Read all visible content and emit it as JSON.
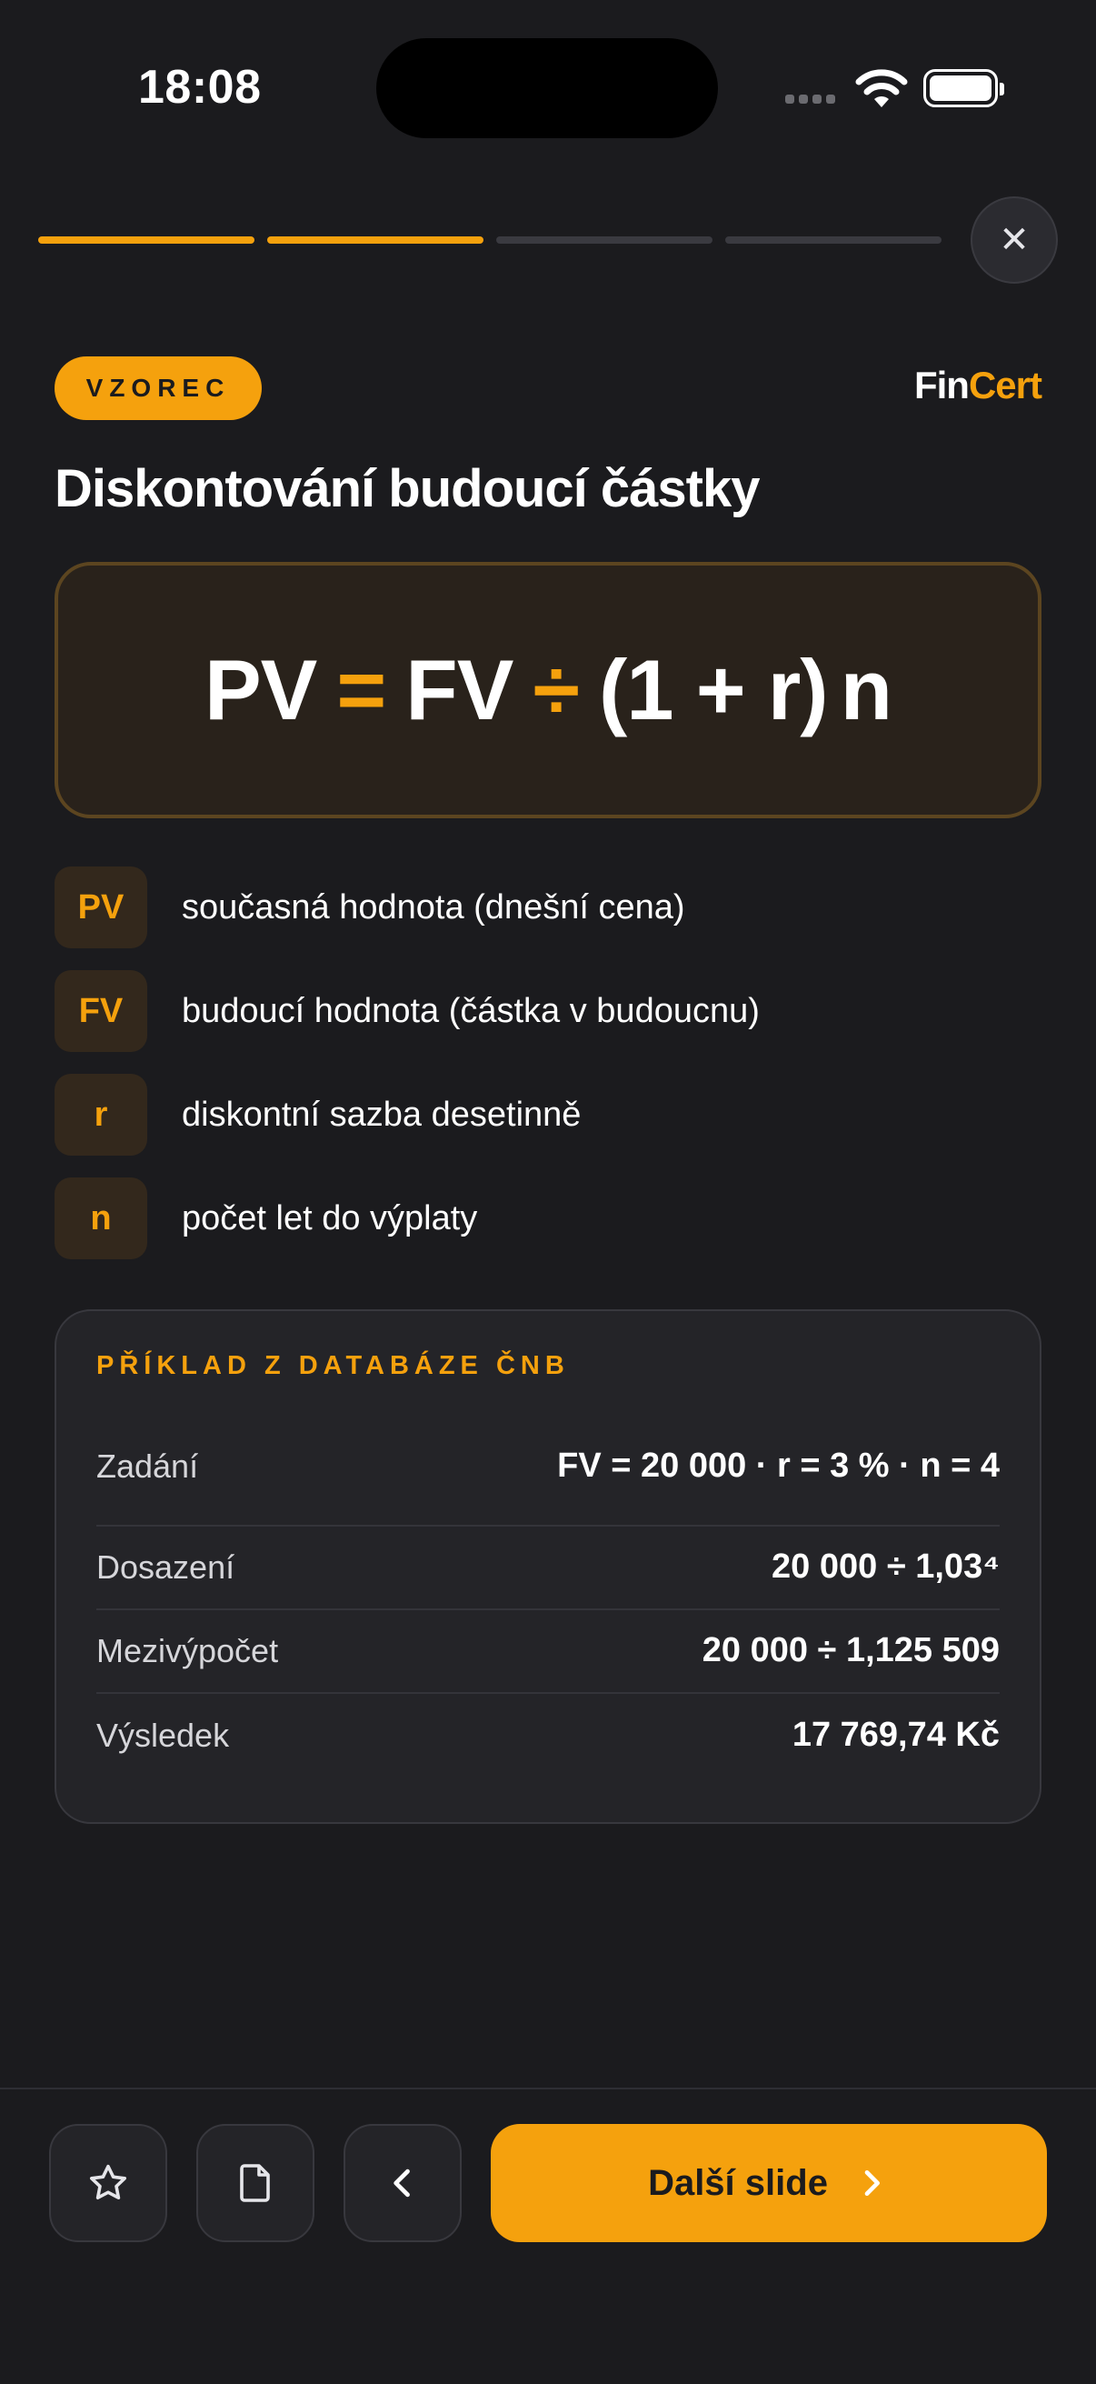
{
  "status": {
    "time": "18:08"
  },
  "progress": {
    "total": 4,
    "completed": 2
  },
  "close": {
    "icon": "close-icon",
    "glyph": "✕"
  },
  "header": {
    "tag": "VZOREC",
    "brand_part1": "Fin",
    "brand_part2": "Cert"
  },
  "title": "Diskontování budoucí částky",
  "formula": {
    "pv": "PV",
    "eq": "=",
    "fv": "FV",
    "div": "÷",
    "group": "(1 + r)",
    "exp": "n"
  },
  "legend": [
    {
      "symbol": "PV",
      "text": "současná hodnota (dnešní cena)"
    },
    {
      "symbol": "FV",
      "text": "budoucí hodnota (částka v budoucnu)"
    },
    {
      "symbol": "r",
      "text": "diskontní sazba desetinně"
    },
    {
      "symbol": "n",
      "text": "počet let do výplaty"
    }
  ],
  "example": {
    "title": "PŘÍKLAD Z DATABÁZE ČNB",
    "rows": [
      {
        "label": "Zadání",
        "value": "FV = 20 000 · r = 3 % · n = 4"
      },
      {
        "label": "Dosazení",
        "value": "20 000 ÷ 1,03⁴"
      },
      {
        "label": "Mezivýpočet",
        "value": "20 000 ÷ 1,125 509"
      },
      {
        "label": "Výsledek",
        "value": "17 769,74 Kč"
      }
    ]
  },
  "bottom": {
    "next_label": "Další slide",
    "icons": [
      "star-icon",
      "document-icon",
      "chevron-left-icon",
      "chevron-right-icon"
    ]
  },
  "colors": {
    "accent": "#f5a10d",
    "background": "#1b1b1e",
    "card": "#242428"
  }
}
